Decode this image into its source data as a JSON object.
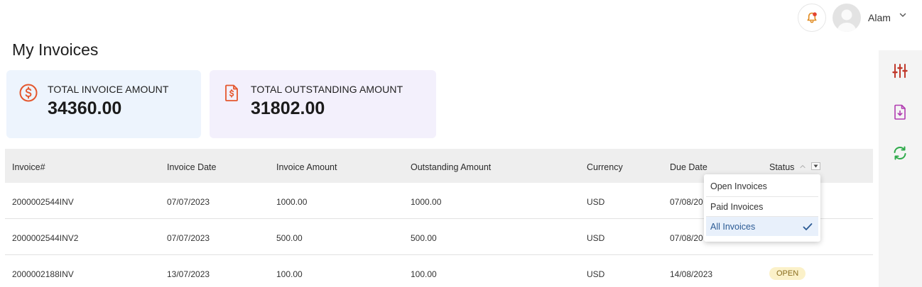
{
  "header": {
    "user_name": "Alam",
    "icons": [
      "bell-icon",
      "avatar",
      "chevron-down-icon"
    ]
  },
  "page": {
    "title": "My Invoices"
  },
  "summary": {
    "total_invoice": {
      "label": "TOTAL INVOICE AMOUNT",
      "value": "34360.00",
      "icon": "dollar-circle-icon"
    },
    "total_outstanding": {
      "label": "TOTAL OUTSTANDING AMOUNT",
      "value": "31802.00",
      "icon": "invoice-dollar-icon"
    }
  },
  "table": {
    "columns": [
      "Invoice#",
      "Invoice Date",
      "Invoice Amount",
      "Outstanding Amount",
      "Currency",
      "Due Date",
      "Status"
    ],
    "rows": [
      {
        "invoice": "2000002544INV",
        "date": "07/07/2023",
        "amount": "1000.00",
        "outstanding": "1000.00",
        "currency": "USD",
        "due": "07/08/20",
        "status": ""
      },
      {
        "invoice": "2000002544INV2",
        "date": "07/07/2023",
        "amount": "500.00",
        "outstanding": "500.00",
        "currency": "USD",
        "due": "07/08/20",
        "status": ""
      },
      {
        "invoice": "2000002188INV",
        "date": "13/07/2023",
        "amount": "100.00",
        "outstanding": "100.00",
        "currency": "USD",
        "due": "14/08/2023",
        "status": "OPEN"
      }
    ]
  },
  "status_filter": {
    "options": [
      "Open Invoices",
      "Paid Invoices",
      "All Invoices"
    ],
    "selected": "All Invoices"
  },
  "rail": {
    "icons": [
      "sliders-icon",
      "download-file-icon",
      "refresh-icon"
    ]
  },
  "colors": {
    "accent_red": "#e4572e",
    "rail_icon_red": "#c0392b",
    "rail_icon_purple": "#b03bb0",
    "rail_icon_green": "#2eaa4a",
    "card_blue": "#edf4fd",
    "card_purple": "#f3f0fc"
  }
}
